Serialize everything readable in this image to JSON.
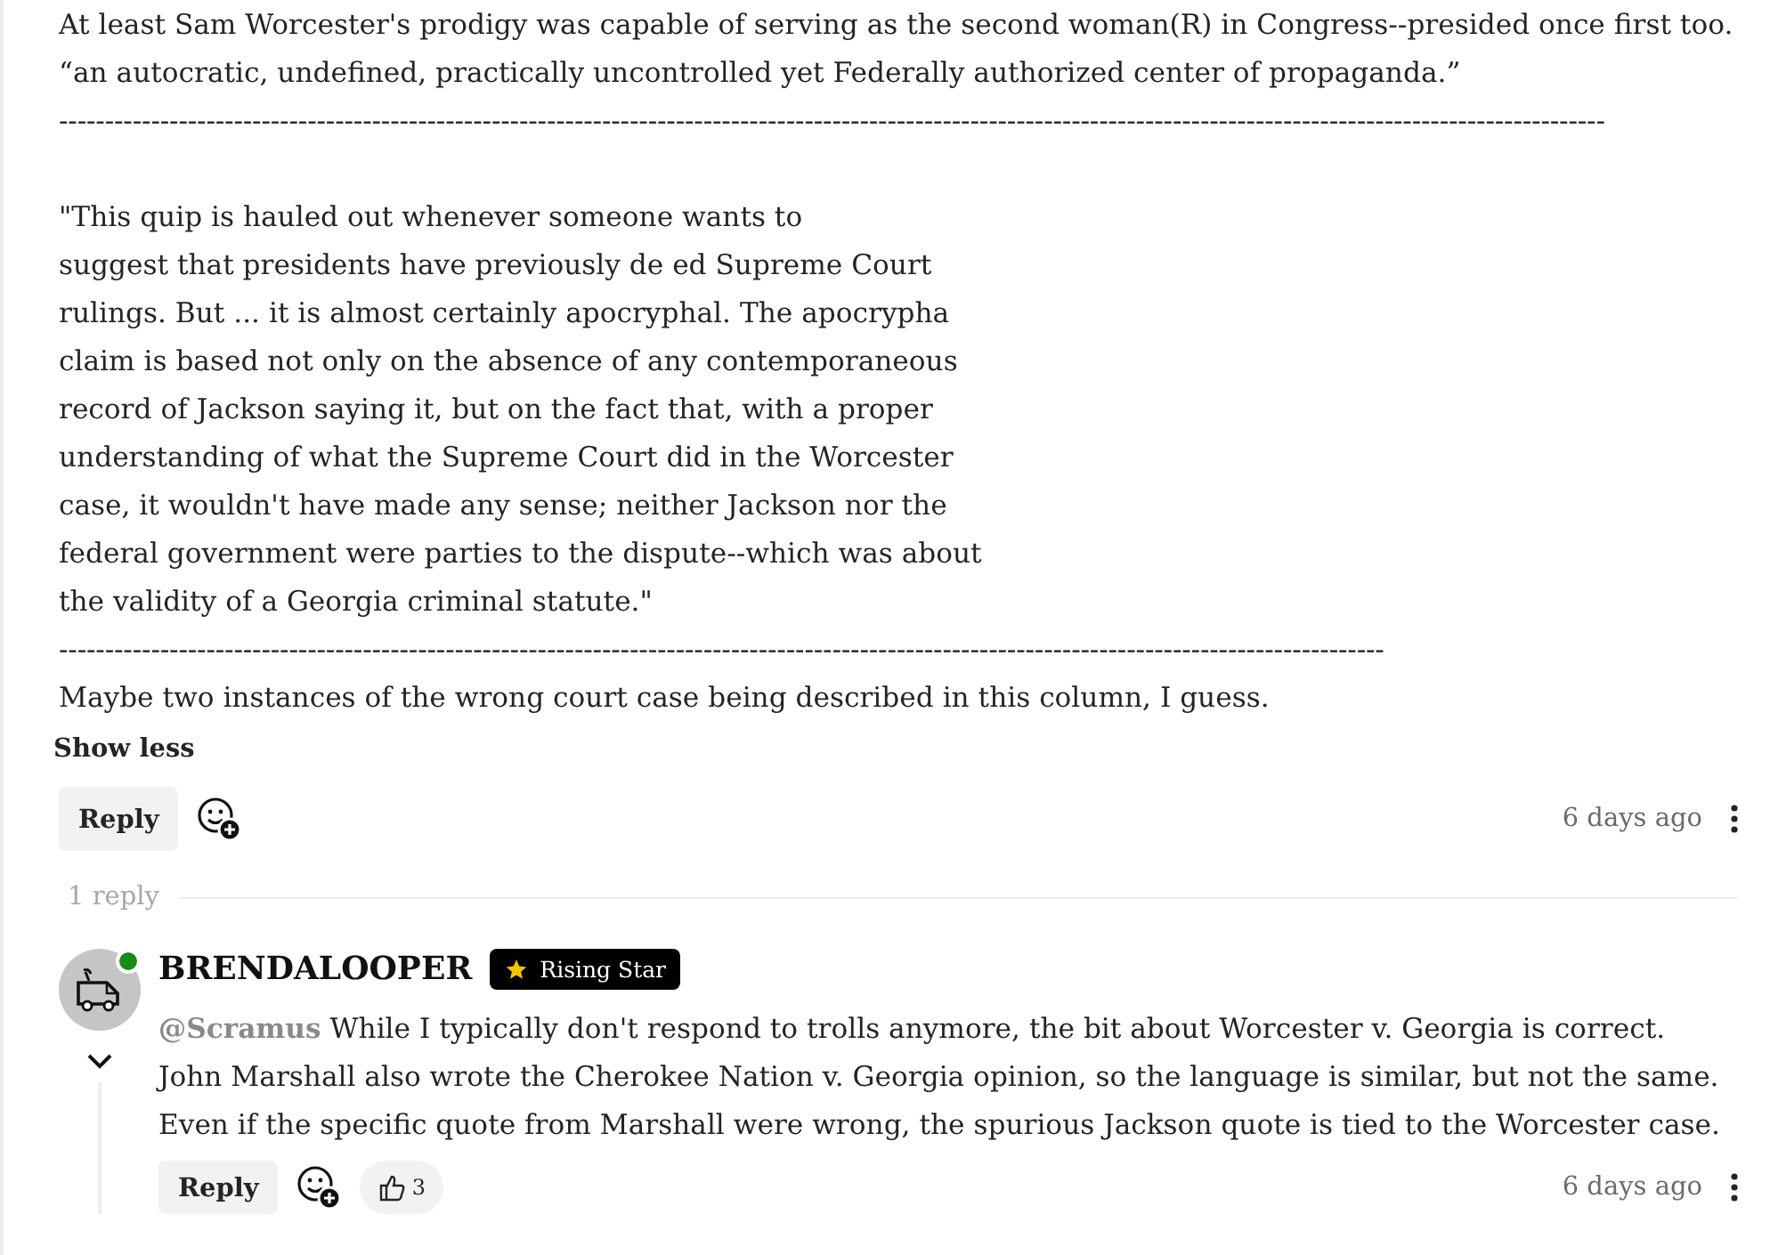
{
  "comment": {
    "blocks": [
      {
        "kind": "line",
        "text": "At least Sam Worcester's prodigy was capable of serving as the second woman(R) in Congress--presided once first too."
      },
      {
        "kind": "line",
        "text": "“an autocratic, undefined, practically uncontrolled yet Federally authorized center of propaganda.”"
      },
      {
        "kind": "rule",
        "text": "------------------------------------------------------------------------------------------------------------------------------------------------------------------------"
      },
      {
        "kind": "quote",
        "text": "\"This quip is hauled out whenever someone wants to\nsuggest that presidents have previously de ed Supreme Court\nrulings. But ... it is almost certainly apocryphal. The apocrypha\nclaim is based not only on the absence of any contemporaneous\nrecord of Jackson saying it, but on the fact that, with a proper\nunderstanding of what the Supreme Court did in the Worcester\ncase, it wouldn't have made any sense; neither Jackson nor the\nfederal government were parties to the dispute--which was about\nthe validity of a Georgia criminal statute.\""
      },
      {
        "kind": "rule",
        "text": "------------------------------------------------------------------------------------------------------------------------------------------------"
      },
      {
        "kind": "line",
        "text": "Maybe two instances of the wrong court case being described in this column, I guess."
      }
    ],
    "toggle": "Show less",
    "reply": "Reply",
    "time": "6 days ago"
  },
  "replies_count": "1 reply",
  "replies": [
    {
      "author": "BRENDALOOPER",
      "online": true,
      "badge": "Rising Star",
      "expanded": true,
      "mention": "@Scramus",
      "text": " While I typically don't respond to trolls anymore, the bit about Worcester v. Georgia is correct.\nJohn Marshall also wrote the Cherokee Nation v. Georgia opinion, so the language is similar, but not the same.\nEven if the specific quote from Marshall were wrong, the spurious Jackson quote is tied to the Worcester case.",
      "reply": "Reply",
      "likes": "3",
      "time": "6 days ago"
    }
  ]
}
